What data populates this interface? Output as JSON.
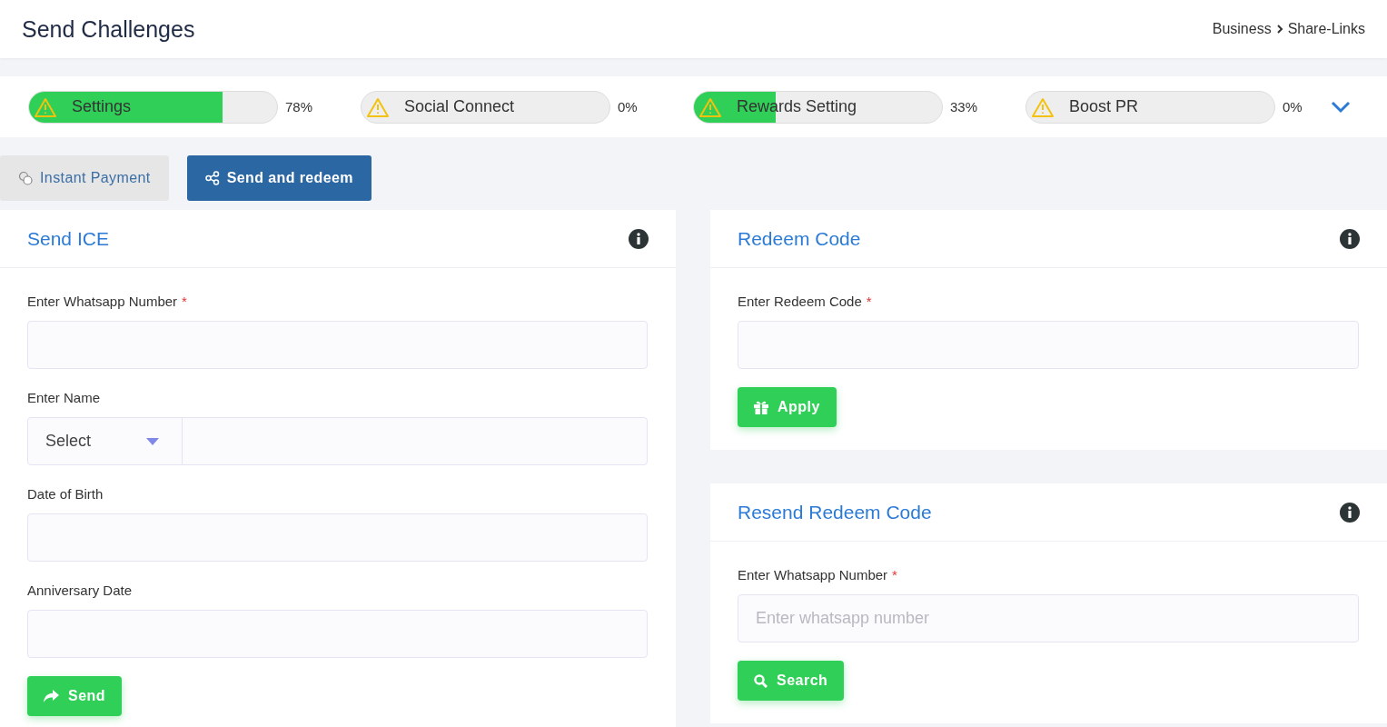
{
  "header": {
    "title": "Send Challenges",
    "breadcrumb": [
      "Business",
      "Share-Links"
    ]
  },
  "progress": [
    {
      "label": "Settings",
      "level": 0.78,
      "reading": "78%"
    },
    {
      "label": "Social Connect",
      "level": 0,
      "reading": "0%"
    },
    {
      "label": "Rewards Setting",
      "level": 0.33,
      "reading": "33%"
    },
    {
      "label": "Boost PR",
      "level": 0,
      "reading": "0%"
    }
  ],
  "tabs": [
    {
      "label": "Instant Payment",
      "selected": false
    },
    {
      "label": "Send and redeem",
      "selected": true
    }
  ],
  "panels": [
    {
      "title": "Send ICE",
      "fields": [
        {
          "kind": "text",
          "label": "Enter Whatsapp Number",
          "required_mark": "*"
        },
        {
          "kind": "select-text",
          "label": "Enter Name",
          "select": "Select"
        },
        {
          "kind": "text",
          "label": "Date of Birth"
        },
        {
          "kind": "text",
          "label": "Anniversary Date"
        }
      ],
      "button": {
        "kind": "send",
        "label": "Send"
      }
    },
    {
      "title": "Redeem Code",
      "fields": [
        {
          "kind": "text",
          "label": "Enter Redeem Code",
          "required_mark": "*"
        }
      ],
      "button": {
        "kind": "apply",
        "label": "Apply"
      }
    },
    {
      "title": "Resend Redeem Code",
      "fields": [
        {
          "kind": "text",
          "label": "Enter Whatsapp Number",
          "required_mark": "*",
          "placeholder": "Enter whatsapp number"
        }
      ],
      "button": {
        "kind": "search",
        "label": "Search"
      }
    }
  ]
}
